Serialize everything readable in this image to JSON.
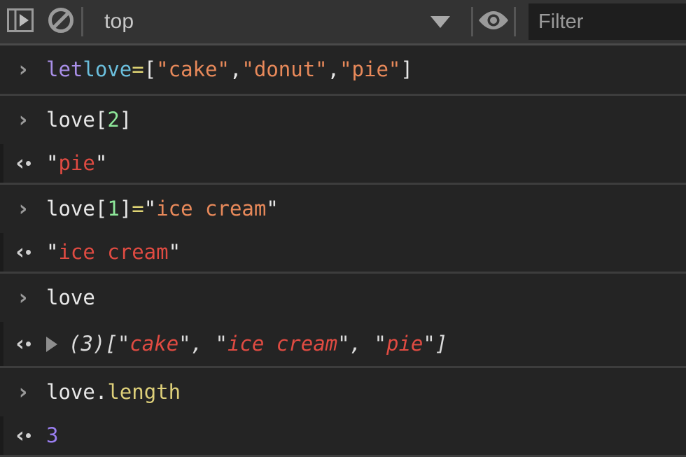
{
  "toolbar": {
    "sidebar_toggle_icon": "console-sidebar-icon",
    "clear_console_icon": "clear-console-icon",
    "context_selector": {
      "value": "top",
      "caret_icon": "chevron-down-icon"
    },
    "live_expression_icon": "eye-icon",
    "filter": {
      "value": "",
      "placeholder": "Filter"
    }
  },
  "console": {
    "input_marker": "›",
    "output_marker": "‹",
    "entries": [
      {
        "type": "input",
        "name": "console-input-1",
        "tokens": [
          {
            "text": "let",
            "cls": "t-kw"
          },
          {
            "text": " ",
            "cls": "t-plain"
          },
          {
            "text": "love",
            "cls": "t-var"
          },
          {
            "text": " ",
            "cls": "t-plain"
          },
          {
            "text": "=",
            "cls": "t-op"
          },
          {
            "text": " [",
            "cls": "t-plain"
          },
          {
            "text": "\"cake\"",
            "cls": "t-str-in"
          },
          {
            "text": ", ",
            "cls": "t-plain"
          },
          {
            "text": "\"donut\"",
            "cls": "t-str-in"
          },
          {
            "text": ", ",
            "cls": "t-plain"
          },
          {
            "text": "\"pie\"",
            "cls": "t-str-in"
          },
          {
            "text": "]",
            "cls": "t-plain"
          }
        ]
      },
      {
        "type": "input",
        "name": "console-input-2",
        "tokens": [
          {
            "text": "love",
            "cls": "t-plain"
          },
          {
            "text": "[",
            "cls": "t-plain"
          },
          {
            "text": "2",
            "cls": "t-num"
          },
          {
            "text": "]",
            "cls": "t-plain"
          }
        ]
      },
      {
        "type": "output",
        "name": "console-output-2",
        "tokens": [
          {
            "text": "\"",
            "cls": "t-plain"
          },
          {
            "text": "pie",
            "cls": "t-str-out"
          },
          {
            "text": "\"",
            "cls": "t-plain"
          }
        ]
      },
      {
        "type": "input",
        "name": "console-input-3",
        "tokens": [
          {
            "text": "love",
            "cls": "t-plain"
          },
          {
            "text": "[",
            "cls": "t-plain"
          },
          {
            "text": "1",
            "cls": "t-num"
          },
          {
            "text": "] ",
            "cls": "t-plain"
          },
          {
            "text": "=",
            "cls": "t-op"
          },
          {
            "text": " ",
            "cls": "t-plain"
          },
          {
            "text": "\"",
            "cls": "t-plain"
          },
          {
            "text": "ice cream",
            "cls": "t-str-in"
          },
          {
            "text": "\"",
            "cls": "t-plain"
          }
        ]
      },
      {
        "type": "output",
        "name": "console-output-3",
        "tokens": [
          {
            "text": "\"",
            "cls": "t-plain"
          },
          {
            "text": "ice cream",
            "cls": "t-str-out"
          },
          {
            "text": "\"",
            "cls": "t-plain"
          }
        ]
      },
      {
        "type": "input",
        "name": "console-input-4",
        "tokens": [
          {
            "text": "love",
            "cls": "t-plain"
          }
        ]
      },
      {
        "type": "output",
        "name": "console-output-4",
        "expandable": true,
        "expand_icon": "disclosure-triangle-icon",
        "tokens": [
          {
            "text": "(3)",
            "cls": "t-meta"
          },
          {
            "text": " [\"",
            "cls": "t-meta"
          },
          {
            "text": "cake",
            "cls": "t-str-arr"
          },
          {
            "text": "\", \"",
            "cls": "t-meta"
          },
          {
            "text": "ice cream",
            "cls": "t-str-arr"
          },
          {
            "text": "\", \"",
            "cls": "t-meta"
          },
          {
            "text": "pie",
            "cls": "t-str-arr"
          },
          {
            "text": "\"]",
            "cls": "t-meta"
          }
        ]
      },
      {
        "type": "input",
        "name": "console-input-5",
        "tokens": [
          {
            "text": "love",
            "cls": "t-plain"
          },
          {
            "text": ".",
            "cls": "t-plain"
          },
          {
            "text": "length",
            "cls": "t-prop"
          }
        ]
      },
      {
        "type": "output",
        "name": "console-output-5",
        "tokens": [
          {
            "text": "3",
            "cls": "t-num-out"
          }
        ]
      }
    ]
  },
  "colors": {
    "toolbar_bg": "#333333",
    "console_bg": "#242424",
    "row_separator": "#3d3d3d",
    "filter_bg": "#1e1e1e",
    "keyword": "#a98fe8",
    "variable": "#6bbfdd",
    "operator": "#dfd474",
    "string_input": "#e8895a",
    "number_input": "#8ee79a",
    "property": "#ded07a",
    "string_output": "#e04b42",
    "number_output": "#9a7ef0"
  }
}
